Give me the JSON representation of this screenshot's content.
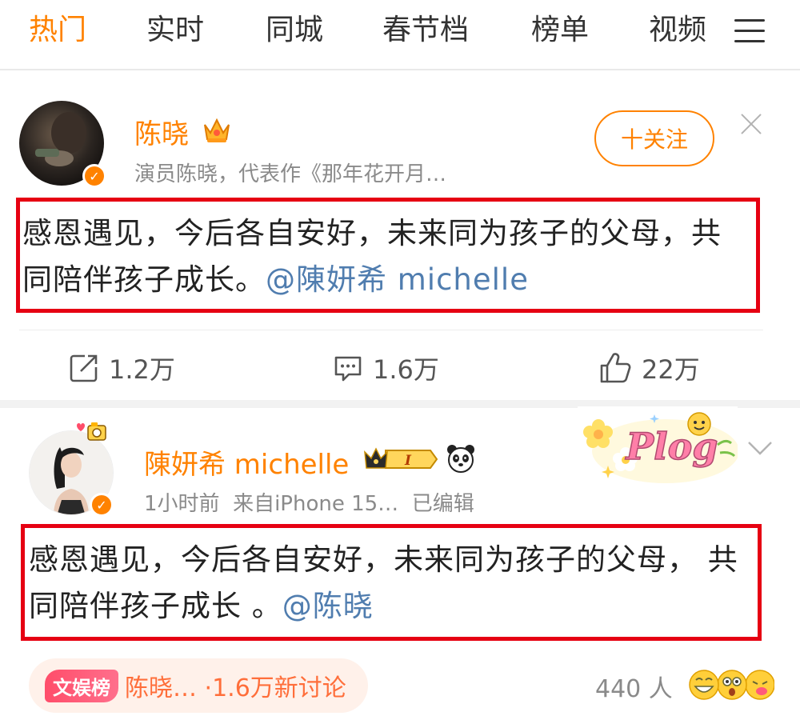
{
  "nav": {
    "tabs": [
      {
        "label": "热门",
        "active": true
      },
      {
        "label": "实时"
      },
      {
        "label": "同城"
      },
      {
        "label": "春节档"
      },
      {
        "label": "榜单"
      },
      {
        "label": "视频"
      }
    ],
    "menu_icon": "hamburger-menu-icon"
  },
  "posts": [
    {
      "username": "陈晓",
      "badge_icon": "crown-icon",
      "subtitle": "演员陈晓，代表作《那年花开月…",
      "follow_label": "十关注",
      "close_icon": "close-icon",
      "content": "感恩遇见，今后各自安好，未来同为孩子的父母，共同陪伴孩子成长。",
      "mention": "@陳妍希 michelle",
      "actions": {
        "repost": "1.2万",
        "comment": "1.6万",
        "like": "22万"
      }
    },
    {
      "username": "陳妍希 michelle",
      "level_badge": "I",
      "meta": "1小时前  来自iPhone 15…  已编辑",
      "content": "感恩遇见，今后各自安好，未来同为孩子的父母， 共同陪伴孩子成长 。",
      "mention": "@陈晓",
      "sticker_text": "Plog",
      "topic_badge": "文娱榜",
      "topic_text": "陈晓… ·1.6万新讨论",
      "people_count": "440 人"
    }
  ],
  "colors": {
    "accent": "#ff8200",
    "link": "#507daf",
    "highlight_box": "#e60012"
  }
}
